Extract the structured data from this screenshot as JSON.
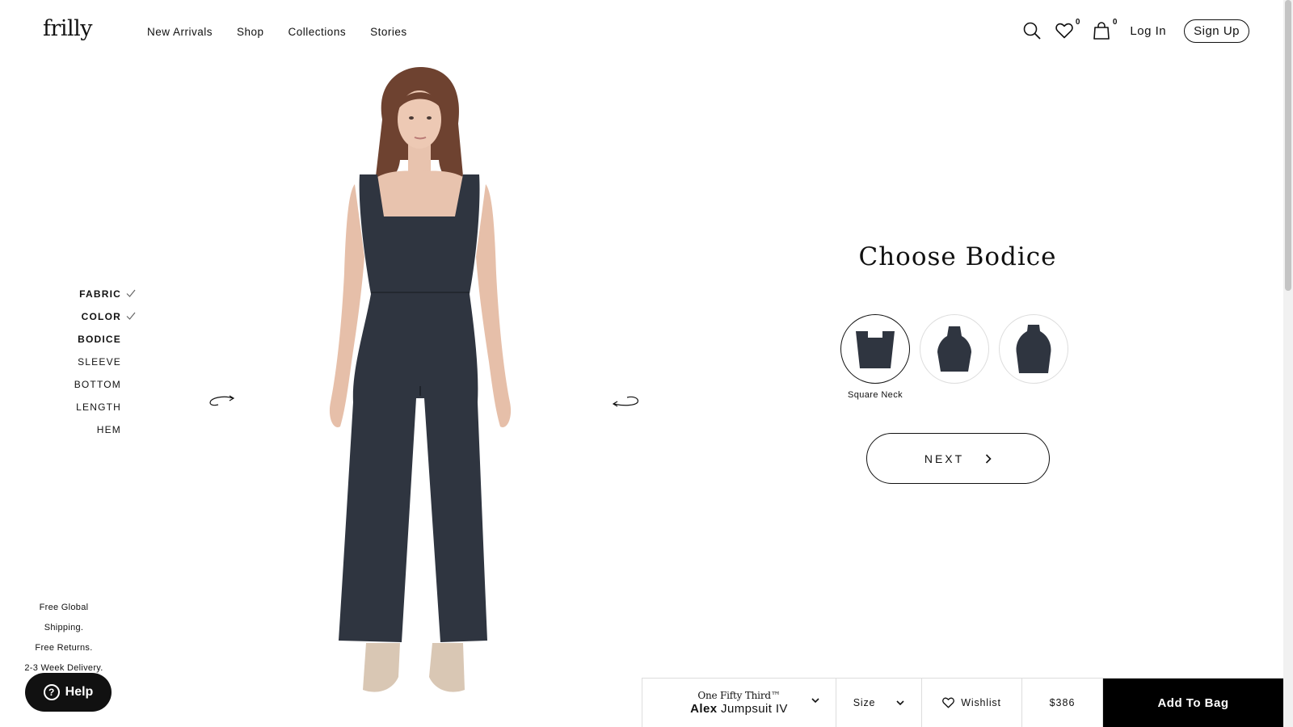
{
  "brand": {
    "logo": "frilly"
  },
  "nav": {
    "items": [
      "New Arrivals",
      "Shop",
      "Collections",
      "Stories"
    ]
  },
  "header": {
    "icons": [
      "search-icon",
      "heart-icon",
      "bag-icon"
    ],
    "wishlist_count": "0",
    "bag_count": "0",
    "login_label": "Log In",
    "signup_label": "Sign Up"
  },
  "steps": [
    {
      "label": "FABRIC",
      "state": "done"
    },
    {
      "label": "COLOR",
      "state": "done"
    },
    {
      "label": "BODICE",
      "state": "active"
    },
    {
      "label": "SLEEVE",
      "state": "pending"
    },
    {
      "label": "BOTTOM",
      "state": "pending"
    },
    {
      "label": "LENGTH",
      "state": "pending"
    },
    {
      "label": "HEM",
      "state": "pending"
    }
  ],
  "shipping": {
    "line1": "Free Global Shipping.",
    "line2": "Free Returns.",
    "line3": "2-3 Week Delivery."
  },
  "help": {
    "label": "Help",
    "icon": "question-icon"
  },
  "chooser": {
    "title": "Choose Bodice",
    "options": [
      {
        "label": "Square Neck",
        "selected": true
      },
      {
        "label": "",
        "selected": false
      },
      {
        "label": "",
        "selected": false
      }
    ],
    "next_label": "NEXT"
  },
  "bar": {
    "brand": "One Fifty Third™",
    "product_bold": "Alex",
    "product_rest": "Jumpsuit IV",
    "size_label": "Size",
    "wishlist_label": "Wishlist",
    "price": "$386",
    "add_label": "Add To Bag"
  },
  "colors": {
    "garment": "#2f3540",
    "accent": "#000000",
    "skin": "#e8c3ae",
    "hair": "#6e4230"
  }
}
